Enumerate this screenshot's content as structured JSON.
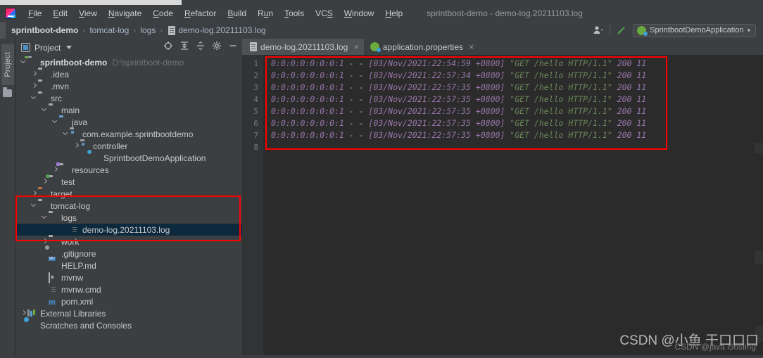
{
  "window": {
    "title": "sprintboot-demo - demo-log.20211103.log",
    "logo_icon": "intellij-idea-logo-icon"
  },
  "menubar": {
    "items": [
      {
        "label": "File",
        "mnemonic": "F"
      },
      {
        "label": "Edit",
        "mnemonic": "E"
      },
      {
        "label": "View",
        "mnemonic": "V"
      },
      {
        "label": "Navigate",
        "mnemonic": "N"
      },
      {
        "label": "Code",
        "mnemonic": "C"
      },
      {
        "label": "Refactor",
        "mnemonic": "R"
      },
      {
        "label": "Build",
        "mnemonic": "B"
      },
      {
        "label": "Run",
        "mnemonic": "u"
      },
      {
        "label": "Tools",
        "mnemonic": "T"
      },
      {
        "label": "VCS",
        "mnemonic": "S"
      },
      {
        "label": "Window",
        "mnemonic": "W"
      },
      {
        "label": "Help",
        "mnemonic": "H"
      }
    ]
  },
  "navbar": {
    "crumbs": [
      {
        "label": "sprintboot-demo",
        "bold": true
      },
      {
        "label": "tomcat-log",
        "bold": false
      },
      {
        "label": "logs",
        "bold": false
      },
      {
        "label": "demo-log.20211103.log",
        "bold": false,
        "icon": "log-file-icon"
      }
    ],
    "separator": "›",
    "profile_icon": "user-profile-icon",
    "profile_caret": "▾",
    "search_icon": "search-everywhere-icon",
    "run_config": {
      "icon": "spring-boot-run-config-icon",
      "label": "SprintbootDemoApplication",
      "caret": "▾"
    }
  },
  "tool_stripe": {
    "project_tab_label": "Project",
    "folder_icon": "folder-icon"
  },
  "project_panel": {
    "header": {
      "icon": "project-view-icon",
      "title": "Project",
      "caret": "▾",
      "tools": [
        {
          "name": "locate-target-icon"
        },
        {
          "name": "expand-all-icon"
        },
        {
          "name": "collapse-all-icon"
        },
        {
          "name": "settings-gear-icon"
        },
        {
          "name": "hide-minimize-icon"
        }
      ]
    },
    "tree": [
      {
        "label": "sprintboot-demo",
        "hint": "D:\\sprintboot-demo",
        "indent": 0,
        "arrow": "down",
        "icon": "module-folder-icon",
        "bold": true,
        "selected": false
      },
      {
        "label": ".idea",
        "hint": "",
        "indent": 1,
        "arrow": "right",
        "icon": "folder-icon",
        "bold": false,
        "selected": false
      },
      {
        "label": ".mvn",
        "hint": "",
        "indent": 1,
        "arrow": "right",
        "icon": "folder-icon",
        "bold": false,
        "selected": false
      },
      {
        "label": "src",
        "hint": "",
        "indent": 1,
        "arrow": "down",
        "icon": "folder-icon",
        "bold": false,
        "selected": false
      },
      {
        "label": "main",
        "hint": "",
        "indent": 2,
        "arrow": "down",
        "icon": "folder-icon",
        "bold": false,
        "selected": false
      },
      {
        "label": "java",
        "hint": "",
        "indent": 3,
        "arrow": "down",
        "icon": "source-root-folder-icon",
        "bold": false,
        "selected": false
      },
      {
        "label": "com.example.sprintbootdemo",
        "hint": "",
        "indent": 4,
        "arrow": "down",
        "icon": "package-icon",
        "bold": false,
        "selected": false
      },
      {
        "label": "controller",
        "hint": "",
        "indent": 5,
        "arrow": "right",
        "icon": "package-icon",
        "bold": false,
        "selected": false
      },
      {
        "label": "SprintbootDemoApplication",
        "hint": "",
        "indent": 6,
        "arrow": "none",
        "icon": "spring-boot-class-icon",
        "bold": false,
        "selected": false
      },
      {
        "label": "resources",
        "hint": "",
        "indent": 3,
        "arrow": "right",
        "icon": "resources-folder-icon",
        "bold": false,
        "selected": false
      },
      {
        "label": "test",
        "hint": "",
        "indent": 2,
        "arrow": "right",
        "icon": "test-folder-icon",
        "bold": false,
        "selected": false
      },
      {
        "label": "target",
        "hint": "",
        "indent": 1,
        "arrow": "right",
        "icon": "excluded-folder-icon",
        "bold": false,
        "selected": false
      },
      {
        "label": "tomcat-log",
        "hint": "",
        "indent": 1,
        "arrow": "down",
        "icon": "folder-icon",
        "bold": false,
        "selected": false
      },
      {
        "label": "logs",
        "hint": "",
        "indent": 2,
        "arrow": "down",
        "icon": "folder-icon",
        "bold": false,
        "selected": false
      },
      {
        "label": "demo-log.20211103.log",
        "hint": "",
        "indent": 4,
        "arrow": "none",
        "icon": "log-file-icon",
        "bold": false,
        "selected": true
      },
      {
        "label": "work",
        "hint": "",
        "indent": 2,
        "arrow": "right",
        "icon": "folder-icon",
        "bold": false,
        "selected": false
      },
      {
        "label": ".gitignore",
        "hint": "",
        "indent": 2,
        "arrow": "none",
        "icon": "gitignore-file-icon",
        "bold": false,
        "selected": false
      },
      {
        "label": "HELP.md",
        "hint": "",
        "indent": 2,
        "arrow": "none",
        "icon": "markdown-file-icon",
        "bold": false,
        "selected": false
      },
      {
        "label": "mvnw",
        "hint": "",
        "indent": 2,
        "arrow": "none",
        "icon": "shell-script-icon",
        "bold": false,
        "selected": false
      },
      {
        "label": "mvnw.cmd",
        "hint": "",
        "indent": 2,
        "arrow": "none",
        "icon": "cmd-file-icon",
        "bold": false,
        "selected": false
      },
      {
        "label": "pom.xml",
        "hint": "",
        "indent": 2,
        "arrow": "none",
        "icon": "maven-pom-icon",
        "bold": false,
        "selected": false
      },
      {
        "label": "External Libraries",
        "hint": "",
        "indent": 0,
        "arrow": "right",
        "icon": "external-libraries-icon",
        "bold": false,
        "selected": false
      },
      {
        "label": "Scratches and Consoles",
        "hint": "",
        "indent": 0,
        "arrow": "none",
        "icon": "scratches-icon",
        "bold": false,
        "selected": false
      }
    ]
  },
  "editor": {
    "tabs": [
      {
        "label": "demo-log.20211103.log",
        "icon": "log-file-icon",
        "active": true,
        "close": "×"
      },
      {
        "label": "application.properties",
        "icon": "spring-properties-icon",
        "active": false,
        "close": "×"
      }
    ],
    "line_numbers": [
      "1",
      "2",
      "3",
      "4",
      "5",
      "6",
      "7",
      "8"
    ],
    "lines": [
      {
        "ip": "0:0:0:0:0:0:0:1",
        "dashes": " - - ",
        "date": "[03/Nov/2021:22:54:59 +0800]",
        "request": "\"GET /hello HTTP/1.1\"",
        "status": "200",
        "bytes": "11"
      },
      {
        "ip": "0:0:0:0:0:0:0:1",
        "dashes": " - - ",
        "date": "[03/Nov/2021:22:57:34 +0800]",
        "request": "\"GET /hello HTTP/1.1\"",
        "status": "200",
        "bytes": "11"
      },
      {
        "ip": "0:0:0:0:0:0:0:1",
        "dashes": " - - ",
        "date": "[03/Nov/2021:22:57:35 +0800]",
        "request": "\"GET /hello HTTP/1.1\"",
        "status": "200",
        "bytes": "11"
      },
      {
        "ip": "0:0:0:0:0:0:0:1",
        "dashes": " - - ",
        "date": "[03/Nov/2021:22:57:35 +0800]",
        "request": "\"GET /hello HTTP/1.1\"",
        "status": "200",
        "bytes": "11"
      },
      {
        "ip": "0:0:0:0:0:0:0:1",
        "dashes": " - - ",
        "date": "[03/Nov/2021:22:57:35 +0800]",
        "request": "\"GET /hello HTTP/1.1\"",
        "status": "200",
        "bytes": "11"
      },
      {
        "ip": "0:0:0:0:0:0:0:1",
        "dashes": " - - ",
        "date": "[03/Nov/2021:22:57:35 +0800]",
        "request": "\"GET /hello HTTP/1.1\"",
        "status": "200",
        "bytes": "11"
      },
      {
        "ip": "0:0:0:0:0:0:0:1",
        "dashes": " - - ",
        "date": "[03/Nov/2021:22:57:35 +0800]",
        "request": "\"GET /hello HTTP/1.1\"",
        "status": "200",
        "bytes": "11"
      }
    ]
  },
  "watermark": {
    "main": "CSDN @小鱼 干口口口",
    "sub": "CSDN @java Gosling"
  },
  "colors": {
    "annotation_red": "#ff0000",
    "selection_blue": "#0d293e",
    "editor_bg": "#2b2b2b",
    "panel_bg": "#3c3f41",
    "string_green": "#6a8759",
    "number_purple": "#9876aa"
  }
}
